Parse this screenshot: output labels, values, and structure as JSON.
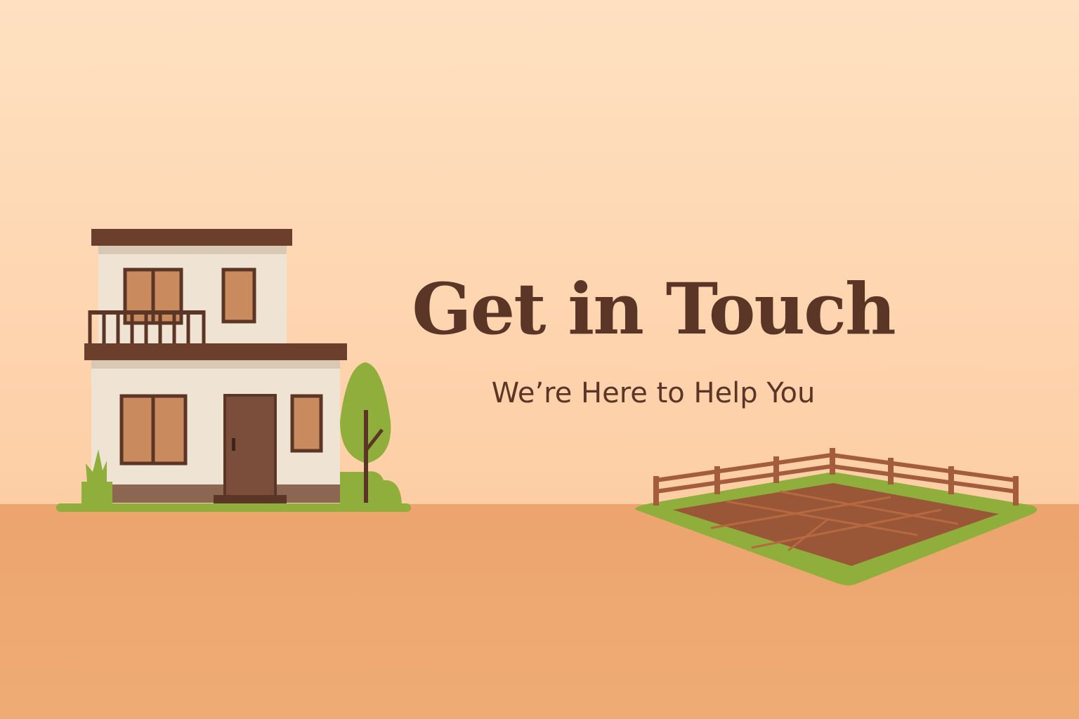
{
  "hero": {
    "headline": "Get in Touch",
    "subheadline": "We’re Here to Help You"
  },
  "illustrations": {
    "house": "two-story-house-icon",
    "tree": "tree-icon",
    "bush": "bush-icon",
    "plot": "fenced-land-plot-icon"
  },
  "colors": {
    "text": "#5b3526",
    "sky": "#fee1c1",
    "ground": "#eda46e",
    "wall": "#efe3d3",
    "roof": "#6b3f2b",
    "window": "#c98a5e",
    "door": "#7a4e3a",
    "grass": "#8fae3b",
    "soil": "#9a5738",
    "fence": "#a35d3c"
  }
}
